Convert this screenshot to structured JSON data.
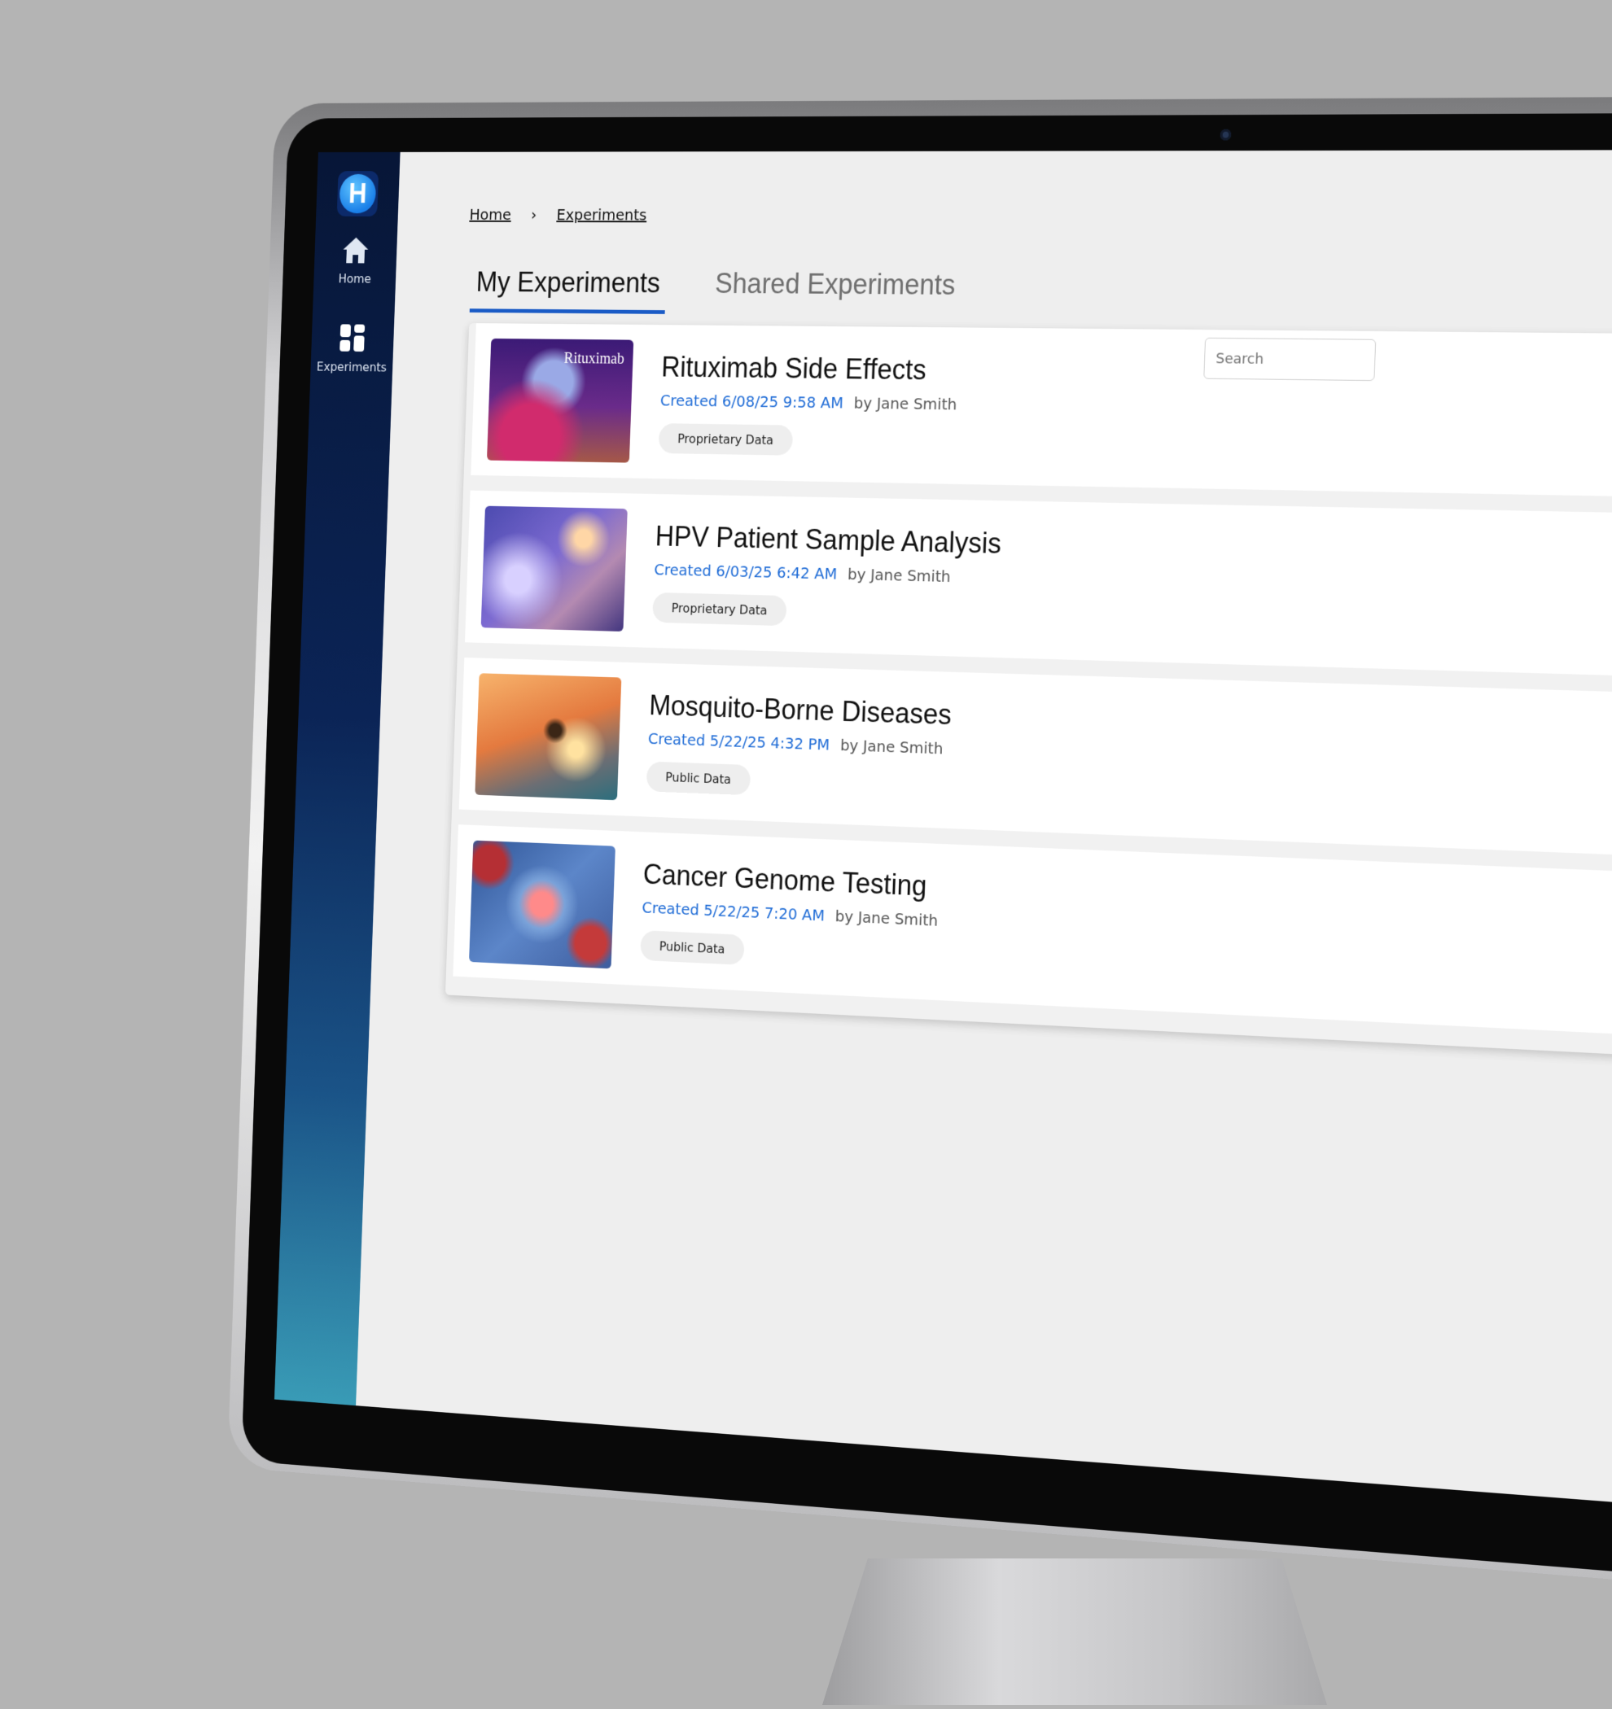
{
  "sidebar": {
    "logo_letter": "H",
    "items": [
      {
        "label": "Home",
        "icon": "home-icon"
      },
      {
        "label": "Experiments",
        "icon": "grid-icon"
      }
    ]
  },
  "breadcrumb": {
    "home": "Home",
    "separator": "›",
    "current": "Experiments"
  },
  "tabs": [
    {
      "label": "My Experiments",
      "active": true
    },
    {
      "label": "Shared Experiments",
      "active": false
    }
  ],
  "search": {
    "placeholder": "Search"
  },
  "experiments": [
    {
      "title": "Rituximab Side Effects",
      "created": "Created 6/08/25 9:58 AM",
      "author": "by Jane Smith",
      "tag": "Proprietary Data",
      "thumb_label": "Rituximab"
    },
    {
      "title": "HPV Patient Sample Analysis",
      "created": "Created 6/03/25 6:42 AM",
      "author": "by Jane Smith",
      "tag": "Proprietary Data"
    },
    {
      "title": "Mosquito-Borne Diseases",
      "created": "Created 5/22/25 4:32 PM",
      "author": "by Jane Smith",
      "tag": "Public Data"
    },
    {
      "title": "Cancer Genome Testing",
      "created": "Created 5/22/25 7:20 AM",
      "author": "by Jane Smith",
      "tag": "Public Data"
    }
  ],
  "colors": {
    "accent": "#1a5bc6",
    "created_text": "#1e6bd6",
    "sidebar_top": "#071637",
    "sidebar_bottom": "#399bb6"
  }
}
